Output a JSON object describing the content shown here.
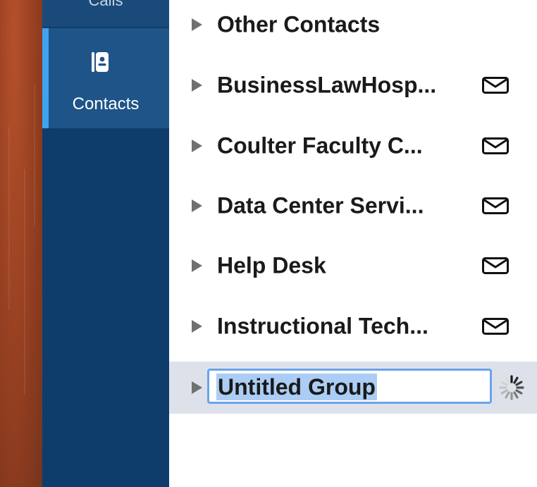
{
  "app_sidebar": {
    "previous_item_label": "Calls",
    "active_item": {
      "label": "Contacts",
      "icon": "contacts-book-icon"
    },
    "colors": {
      "background": "#0f3d6b",
      "active_background": "#1f5488",
      "accent": "#3fa2f0"
    }
  },
  "groups": [
    {
      "name": "Other Contacts",
      "has_mail": false
    },
    {
      "name": "BusinessLawHosp...",
      "has_mail": true
    },
    {
      "name": "Coulter Faculty C...",
      "has_mail": true
    },
    {
      "name": "Data Center Servi...",
      "has_mail": true
    },
    {
      "name": "Help Desk",
      "has_mail": true
    },
    {
      "name": "Instructional Tech...",
      "has_mail": true
    }
  ],
  "new_group": {
    "value": "Untitled Group",
    "status_icon": "loading-spinner-icon",
    "highlight_color": "#abcdf5",
    "focus_color": "#6aa4ea"
  }
}
